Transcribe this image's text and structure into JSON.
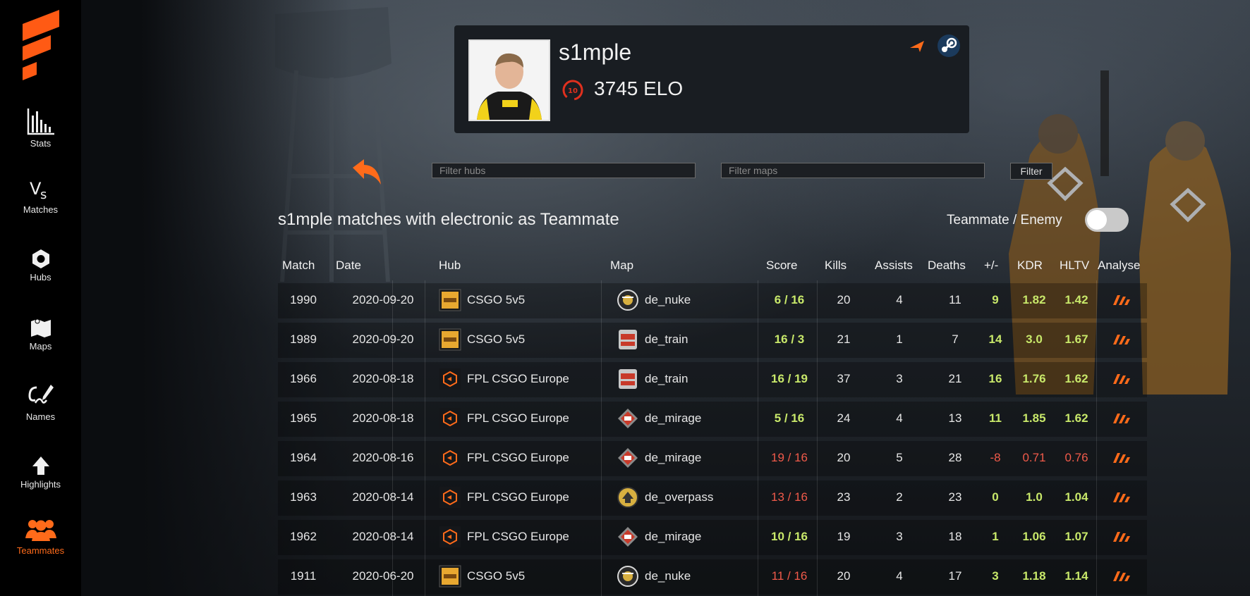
{
  "sidebar": {
    "items": [
      {
        "label": "Stats",
        "icon": "bar-chart-icon"
      },
      {
        "label": "Matches",
        "icon": "versus-icon"
      },
      {
        "label": "Hubs",
        "icon": "hexagon-icon"
      },
      {
        "label": "Maps",
        "icon": "map-icon"
      },
      {
        "label": "Names",
        "icon": "signature-icon"
      },
      {
        "label": "Highlights",
        "icon": "arrow-up-icon"
      },
      {
        "label": "Teammates",
        "icon": "people-icon",
        "active": true
      }
    ]
  },
  "profile": {
    "name": "s1mple",
    "level": "10",
    "elo": "3745 ELO"
  },
  "filters": {
    "hubs_placeholder": "Filter hubs",
    "maps_placeholder": "Filter maps",
    "button_label": "Filter"
  },
  "section_title": "s1mple matches with electronic as Teammate",
  "toggle_label": "Teammate / Enemy",
  "table": {
    "headers": [
      "Match",
      "Date",
      "Hub",
      "Map",
      "Score",
      "Kills",
      "Assists",
      "Deaths",
      "+/-",
      "KDR",
      "HLTV",
      "Analyse"
    ],
    "rows": [
      {
        "match": "1990",
        "date": "2020-09-20",
        "hub": "CSGO 5v5",
        "hub_icon": "csgo-hub-icon",
        "map": "de_nuke",
        "score": "6 / 16",
        "kills": "20",
        "assists": "4",
        "deaths": "11",
        "diff": "9",
        "kdr": "1.82",
        "hltv": "1.42"
      },
      {
        "match": "1989",
        "date": "2020-09-20",
        "hub": "CSGO 5v5",
        "hub_icon": "csgo-hub-icon",
        "map": "de_train",
        "score": "16 / 3",
        "kills": "21",
        "assists": "1",
        "deaths": "7",
        "diff": "14",
        "kdr": "3.0",
        "hltv": "1.67"
      },
      {
        "match": "1966",
        "date": "2020-08-18",
        "hub": "FPL CSGO Europe",
        "hub_icon": "fpl-hub-icon",
        "map": "de_train",
        "score": "16 / 19",
        "kills": "37",
        "assists": "3",
        "deaths": "21",
        "diff": "16",
        "kdr": "1.76",
        "hltv": "1.62"
      },
      {
        "match": "1965",
        "date": "2020-08-18",
        "hub": "FPL CSGO Europe",
        "hub_icon": "fpl-hub-icon",
        "map": "de_mirage",
        "score": "5 / 16",
        "kills": "24",
        "assists": "4",
        "deaths": "13",
        "diff": "11",
        "kdr": "1.85",
        "hltv": "1.62"
      },
      {
        "match": "1964",
        "date": "2020-08-16",
        "hub": "FPL CSGO Europe",
        "hub_icon": "fpl-hub-icon",
        "map": "de_mirage",
        "score": "19 / 16",
        "kills": "20",
        "assists": "5",
        "deaths": "28",
        "diff": "-8",
        "kdr": "0.71",
        "hltv": "0.76"
      },
      {
        "match": "1963",
        "date": "2020-08-14",
        "hub": "FPL CSGO Europe",
        "hub_icon": "fpl-hub-icon",
        "map": "de_overpass",
        "score": "13 / 16",
        "kills": "23",
        "assists": "2",
        "deaths": "23",
        "diff": "0",
        "kdr": "1.0",
        "hltv": "1.04"
      },
      {
        "match": "1962",
        "date": "2020-08-14",
        "hub": "FPL CSGO Europe",
        "hub_icon": "fpl-hub-icon",
        "map": "de_mirage",
        "score": "10 / 16",
        "kills": "19",
        "assists": "3",
        "deaths": "18",
        "diff": "1",
        "kdr": "1.06",
        "hltv": "1.07"
      },
      {
        "match": "1911",
        "date": "2020-06-20",
        "hub": "CSGO 5v5",
        "hub_icon": "csgo-hub-icon",
        "map": "de_nuke",
        "score": "11 / 16",
        "kills": "20",
        "assists": "4",
        "deaths": "17",
        "diff": "3",
        "kdr": "1.18",
        "hltv": "1.14"
      }
    ]
  },
  "colors": {
    "accent": "#ff6b1a",
    "positive": "#c8e86a",
    "negative": "#f05a4a",
    "sidebar_bg": "#000000",
    "card_bg": "#191d22"
  }
}
